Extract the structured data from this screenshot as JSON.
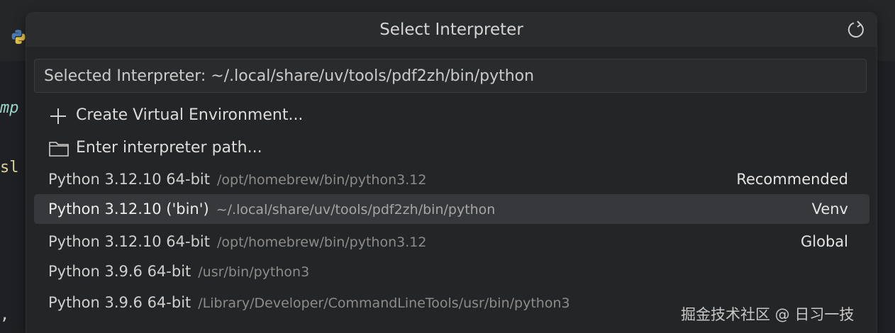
{
  "editor": {
    "code_fragments": [
      "mp",
      "sl",
      ","
    ]
  },
  "picker": {
    "title": "Select Interpreter",
    "refresh_icon": "refresh-icon",
    "input_value": "Selected Interpreter: ~/.local/share/uv/tools/pdf2zh/bin/python",
    "actions": [
      {
        "icon": "plus-icon",
        "label": "Create Virtual Environment..."
      },
      {
        "icon": "folder-icon",
        "label": "Enter interpreter path..."
      }
    ],
    "interpreters": [
      {
        "name": "Python 3.12.10 64-bit",
        "path": "/opt/homebrew/bin/python3.12",
        "badge": "Recommended",
        "active": false
      },
      {
        "name": "Python 3.12.10 ('bin')",
        "path": "~/.local/share/uv/tools/pdf2zh/bin/python",
        "badge": "Venv",
        "active": true
      },
      {
        "name": "Python 3.12.10 64-bit",
        "path": "/opt/homebrew/bin/python3.12",
        "badge": "Global",
        "active": false
      },
      {
        "name": "Python 3.9.6 64-bit",
        "path": "/usr/bin/python3",
        "badge": "",
        "active": false
      },
      {
        "name": "Python 3.9.6 64-bit",
        "path": "/Library/Developer/CommandLineTools/usr/bin/python3",
        "badge": "",
        "active": false
      }
    ]
  },
  "watermark": "掘金技术社区 @ 日习一技",
  "colors": {
    "background": "#1f2023",
    "picker_bg": "#242526",
    "active_row": "#37383b",
    "text": "#cfcfcf",
    "path_text": "#8c8c8c"
  }
}
